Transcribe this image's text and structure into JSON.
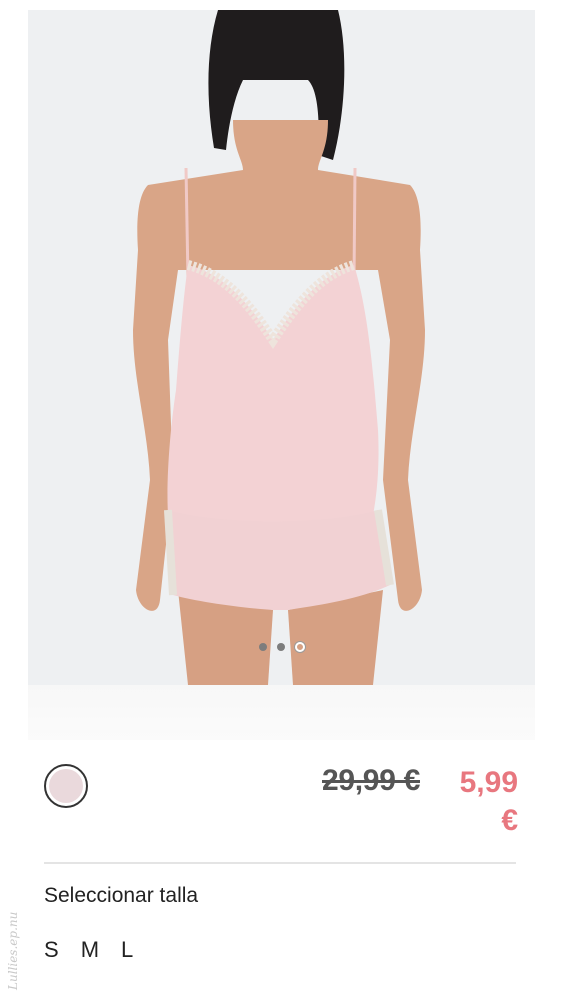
{
  "product": {
    "image_alt": "back-view-camisole-shorts-set",
    "gallery": {
      "total": 3,
      "active_index": 2
    },
    "color_swatch": {
      "color": "#ead9dc"
    },
    "price": {
      "old": "29,99 €",
      "new": "5,99 €",
      "new_color": "#e8777f"
    }
  },
  "size_selector": {
    "title": "Seleccionar talla",
    "options": [
      "S",
      "M",
      "L"
    ]
  },
  "watermark": "Lullies.ep.nu"
}
